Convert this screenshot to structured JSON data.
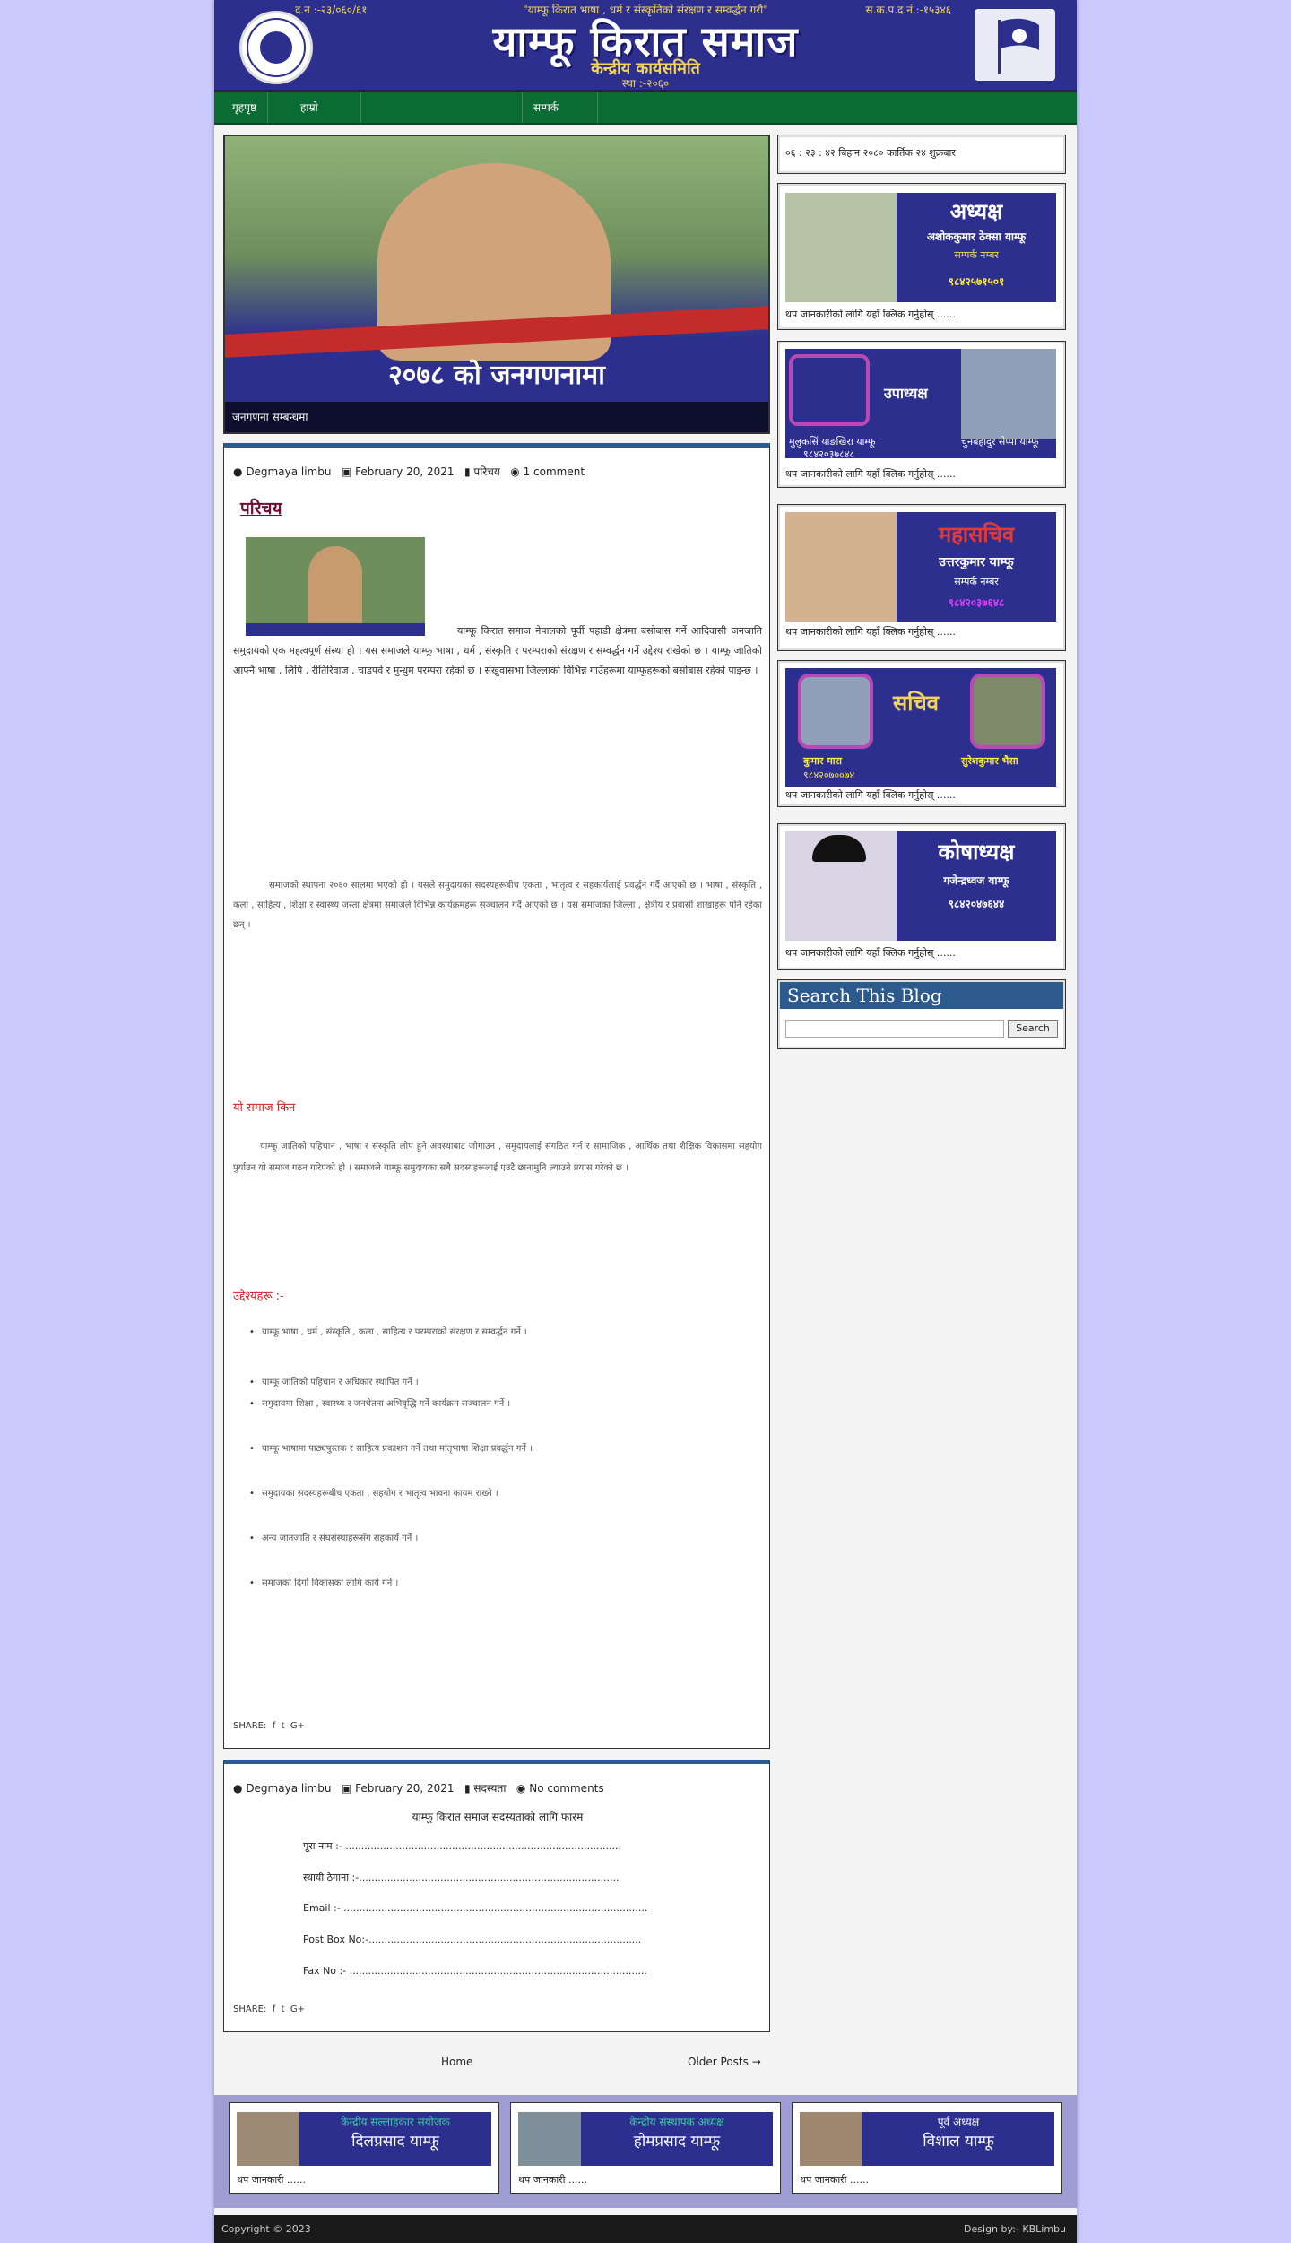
{
  "header": {
    "left_small": "द.न :-२३/०६०/६१",
    "center_small": "\"याम्फू किरात भाषा , धर्म र संस्कृतिको संरक्षण र सम्वर्द्धन गरौ\"",
    "right_small": "स.क.प.द.नं.:-१५३४६",
    "title": "याम्फू किरात समाज",
    "subtitle": "केन्द्रीय कार्यसमिति",
    "established": "स्था :-२०६०"
  },
  "nav": {
    "items": [
      "गृहपृष्ठ",
      "हाम्रो",
      "सम्पर्क"
    ]
  },
  "slider": {
    "headline": "२०७८ को जनगणनामा",
    "caption": "जनगणना सम्बन्धमा"
  },
  "post1": {
    "author": "Degmaya limbu",
    "date": "February 20, 2021",
    "category": "परिचय",
    "comments": "1 comment",
    "title": "परिचय",
    "para1": "याम्फू किरात समाज नेपालको पूर्वी पहाडी क्षेत्रमा बसोबास गर्ने आदिवासी जनजाति समुदायको एक महत्वपूर्ण संस्था हो । यस समाजले याम्फू भाषा , धर्म , संस्कृति र परम्पराको संरक्षण र सम्वर्द्धन गर्ने उद्देश्य राखेको छ । याम्फू जातिको आफ्नै भाषा , लिपि , रीतिरिवाज , चाडपर्व र मुन्धुम परम्परा रहेको छ । संखुवासभा जिल्लाको विभिन्न गाउँहरूमा याम्फूहरूको बसोबास रहेको पाइन्छ ।",
    "para2": "समाजको स्थापना २०६० सालमा भएको हो । यसले समुदायका सदस्यहरूबीच एकता , भातृत्व र सहकार्यलाई प्रवर्द्धन गर्दै आएको छ । भाषा , संस्कृति , कला , साहित्य , शिक्षा र स्वास्थ्य जस्ता क्षेत्रमा समाजले विभिन्न कार्यक्रमहरू सञ्चालन गर्दै आएको छ । यस समाजका जिल्ला , क्षेत्रीय र प्रवासी शाखाहरू पनि रहेका छन् ।",
    "section1": "यो समाज किन",
    "para3": "याम्फू जातिको पहिचान , भाषा र संस्कृति लोप हुने अवस्थाबाट जोगाउन , समुदायलाई संगठित गर्न र सामाजिक , आर्थिक तथा शैक्षिक विकासमा सहयोग पुर्याउन यो समाज गठन गरिएको हो । समाजले याम्फू समुदायका सबै सदस्यहरूलाई एउटै छानामुनि ल्याउने प्रयास गरेको छ ।",
    "section2": "उद्देश्यहरू :-",
    "bullets": [
      "याम्फू भाषा , धर्म , संस्कृति , कला , साहित्य र परम्पराको संरक्षण र सम्वर्द्धन गर्ने ।",
      "याम्फू जातिको पहिचान र अधिकार स्थापित गर्ने ।",
      "समुदायमा शिक्षा , स्वास्थ्य र जनचेतना अभिवृद्धि गर्ने कार्यक्रम सञ्चालन गर्ने ।",
      "याम्फू भाषामा पाठ्यपुस्तक र साहित्य प्रकाशन गर्ने तथा मातृभाषा शिक्षा प्रवर्द्धन गर्ने ।",
      "समुदायका सदस्यहरूबीच एकता , सहयोग र भातृत्व भावना कायम राख्ने ।",
      "अन्य जातजाति र संघसंस्थाहरूसँग सहकार्य गर्ने ।",
      "समाजको दिगो विकासका लागि कार्य गर्ने ।"
    ],
    "share": "SHARE:"
  },
  "post2": {
    "author": "Degmaya limbu",
    "date": "February 20, 2021",
    "category": "सदस्यता",
    "comments": "No comments",
    "heading": "याम्फू किरात समाज सदस्यताको लागि फारम",
    "fields": [
      "पूरा नाम :- ........................................................................................",
      "स्थायी ठेगाना :-...................................................................................",
      "Email :- .................................................................................................",
      "Post Box No:-.......................................................................................",
      "Fax No :- ...............................................................................................",
      ""
    ],
    "share": "SHARE:"
  },
  "pagination": {
    "home": "Home",
    "older": "Older Posts →"
  },
  "sidebar": {
    "clock": "०६ : २३ : ४२ बिहान  २०८० कार्तिक २४ शुक्रबार",
    "cards": [
      {
        "role": "अध्यक्ष",
        "name": "अशोककुमार ठेक्सा याम्फू",
        "label": "सम्पर्क नम्बर",
        "phone": "९८४२५७१५०१",
        "caption": "थप जानकारीको लागि यहाँ क्लिक गर्नुहोस् ......"
      },
      {
        "role": "उपाध्यक्ष",
        "name": "मुलुकसिं याङखिरा याम्फू",
        "label": "चुनबहादुर सेप्पा याम्फू",
        "phone": "९८४२०३७८४८",
        "caption": "थप जानकारीको लागि यहाँ क्लिक गर्नुहोस् ......"
      },
      {
        "role": "महासचिव",
        "name": "उत्तरकुमार याम्फू",
        "label": "सम्पर्क नम्बर",
        "phone": "९८४२०३७६४८",
        "caption": "थप जानकारीको लागि यहाँ क्लिक गर्नुहोस् ......"
      },
      {
        "role": "सचिव",
        "name": "कुमार मारा",
        "label": "सुरेशकुमार भैसा",
        "phone": "९८४२०७००७४",
        "caption": "थप जानकारीको लागि यहाँ क्लिक गर्नुहोस् ......"
      },
      {
        "role": "कोषाध्यक्ष",
        "name": "गजेन्द्रध्वज याम्फू",
        "label": "",
        "phone": "९८४२०४७६४४",
        "caption": "थप जानकारीको लागि यहाँ क्लिक गर्नुहोस् ......"
      }
    ],
    "search_title": "Search This Blog",
    "search_button": "Search"
  },
  "bottom": [
    {
      "role": "केन्द्रीय सल्लाहकार संयोजक",
      "name": "दिलप्रसाद याम्फू",
      "caption": "थप जानकारी ......"
    },
    {
      "role": "केन्द्रीय संस्थापक अध्यक्ष",
      "name": "होमप्रसाद याम्फू",
      "caption": "थप जानकारी ......"
    },
    {
      "role": "पूर्व अध्यक्ष",
      "name": "विशाल याम्फू",
      "caption": "थप जानकारी ......"
    }
  ],
  "footer": {
    "copyright": "Copyright © 2023",
    "design": "Design by:- KBLimbu"
  }
}
